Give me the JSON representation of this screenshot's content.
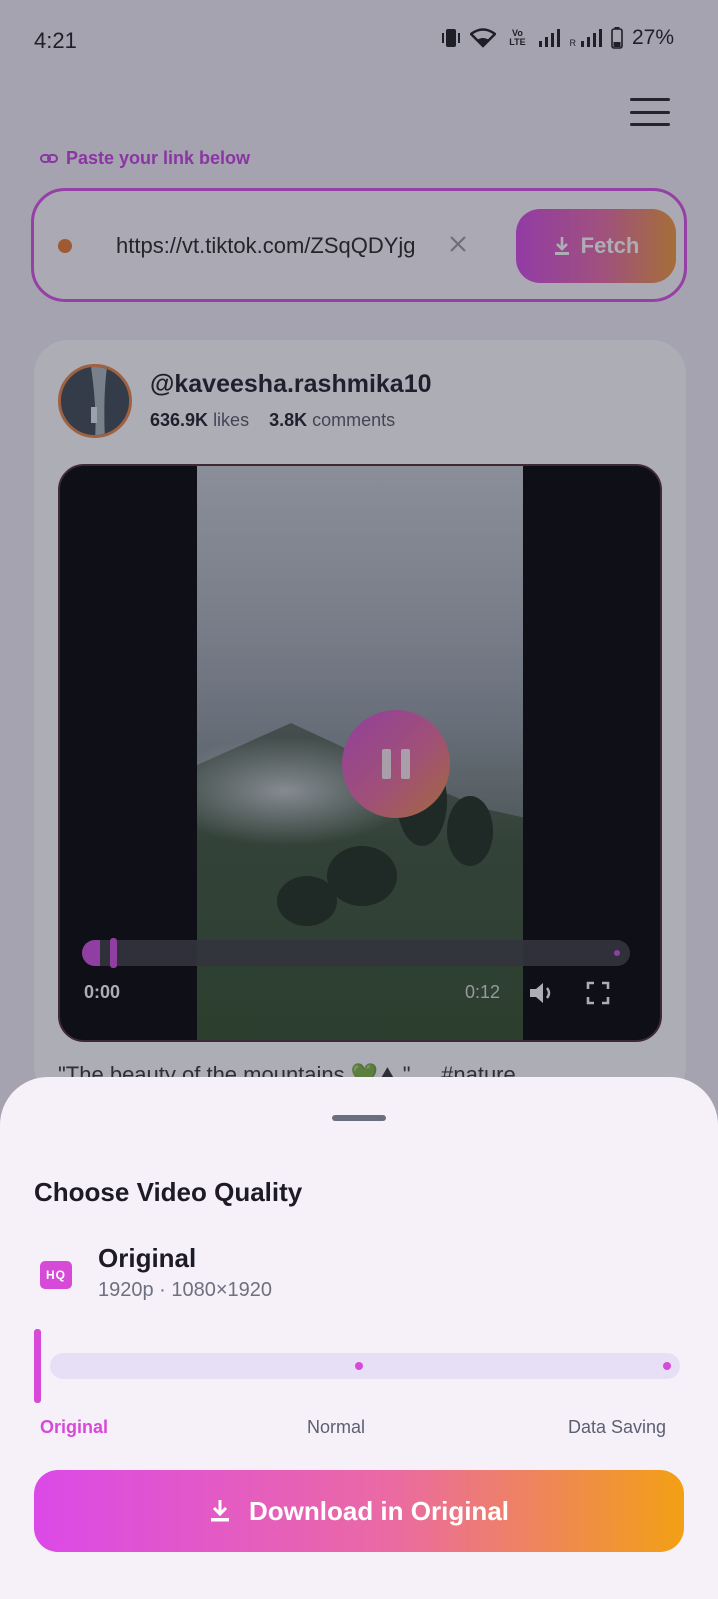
{
  "status_bar": {
    "time": "4:21",
    "volte": "Vo LTE",
    "roaming": "R",
    "battery": "27%"
  },
  "header": {
    "menu_icon": "hamburger-icon"
  },
  "input": {
    "label": "Paste your link below",
    "url": "https://vt.tiktok.com/ZSqQDYjg",
    "clear_icon": "close-icon",
    "fetch_label": "Fetch"
  },
  "post": {
    "username": "@kaveesha.rashmika10",
    "likes_count": "636.9K",
    "likes_label": "likes",
    "comments_count": "3.8K",
    "comments_label": "comments",
    "caption": "\"The beauty of the mountains 💚⛰.\" ... #nature"
  },
  "player": {
    "current_time": "0:00",
    "duration": "0:12",
    "progress": 0,
    "state": "playing"
  },
  "sheet": {
    "title": "Choose Video Quality",
    "badge": "HQ",
    "selected_quality": "Original",
    "selected_spec": "1920p · 1080×1920",
    "options": [
      "Original",
      "Normal",
      "Data Saving"
    ],
    "selected_index": 0,
    "download_label": "Download in Original"
  },
  "colors": {
    "accent": "#d64ad7",
    "gradient_start": "#dc49e8",
    "gradient_end": "#f3a014"
  }
}
